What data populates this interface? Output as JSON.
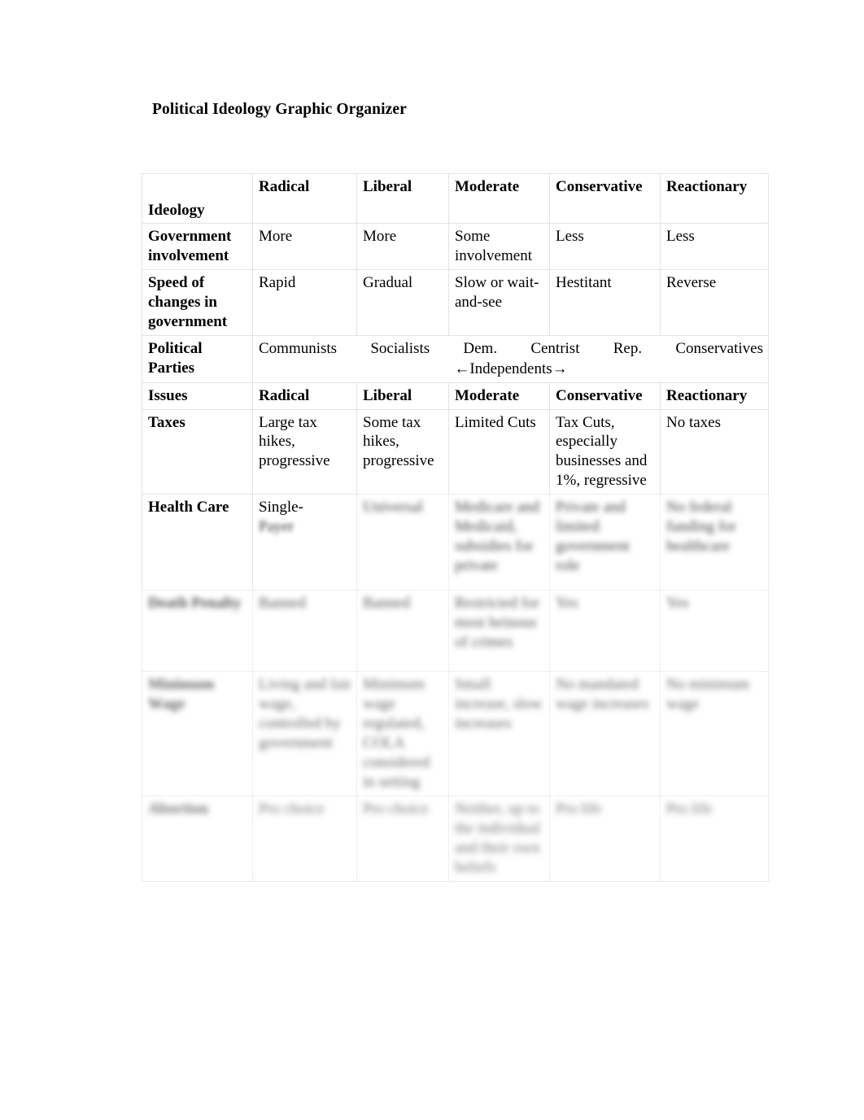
{
  "document": {
    "title": "Political Ideology Graphic Organizer"
  },
  "table": {
    "ideology_header": {
      "label": "Ideology",
      "columns": [
        "Radical",
        "Liberal",
        "Moderate",
        "Conservative",
        "Reactionary"
      ]
    },
    "issues_header": {
      "label": "Issues",
      "columns": [
        "Radical",
        "Liberal",
        "Moderate",
        "Conservative",
        "Reactionary"
      ]
    },
    "rows": [
      {
        "label": "Government involvement",
        "cells": [
          "More",
          "More",
          "Some involvement",
          "Less",
          "Less"
        ]
      },
      {
        "label": "Speed of changes in government",
        "cells": [
          "Rapid",
          "Gradual",
          "Slow or wait-and-see",
          "Hestitant",
          "Reverse"
        ]
      },
      {
        "label": "Political Parties",
        "parties_line1": [
          "Communists",
          "Socialists",
          "Dem.",
          "Centrist",
          "Rep.",
          "Conservatives"
        ],
        "parties_line2": "←Independents→"
      },
      {
        "label": "Taxes",
        "cells": [
          "Large tax hikes, progressive",
          "Some tax hikes, progressive",
          "Limited Cuts",
          "Tax Cuts, especially businesses and 1%, regressive",
          "No taxes"
        ]
      },
      {
        "label": "Health Care",
        "cells": [
          "Single-",
          "",
          "",
          "",
          ""
        ]
      },
      {
        "label": "",
        "cells": [
          "",
          "",
          "",
          "",
          ""
        ]
      },
      {
        "label": "",
        "cells": [
          "",
          "",
          "",
          "",
          ""
        ]
      },
      {
        "label": "",
        "cells": [
          "",
          "",
          "",
          "",
          ""
        ]
      }
    ],
    "blurred_note": {
      "health_care_partial": "Single-",
      "illegible": ""
    }
  },
  "colors": {
    "page_background": "#ffffff",
    "text": "#000000",
    "header_shade": "#e9e9e9",
    "border": "#e3e3e3"
  }
}
